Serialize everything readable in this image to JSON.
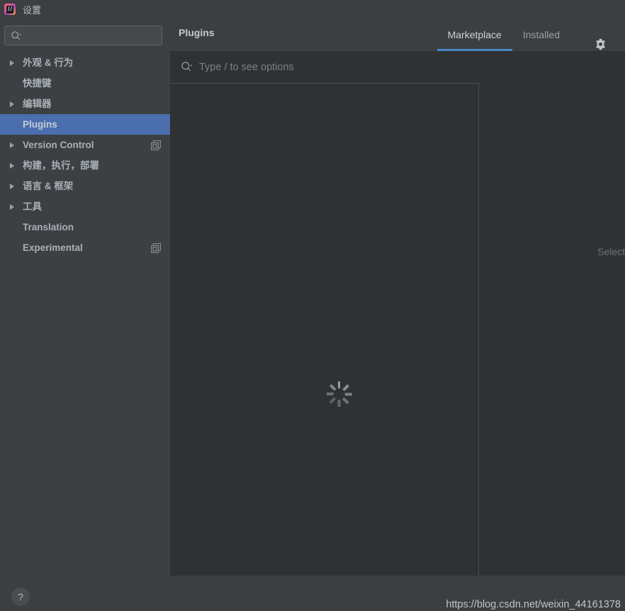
{
  "window": {
    "title": "设置",
    "app_icon": "intellij-idea-icon"
  },
  "sidebar": {
    "search": {
      "value": "",
      "placeholder": "",
      "icon": "search-icon"
    },
    "items": [
      {
        "label": "外观 & 行为",
        "expandable": true,
        "selected": false,
        "badge": ""
      },
      {
        "label": "快捷键",
        "expandable": false,
        "selected": false,
        "badge": ""
      },
      {
        "label": "编辑器",
        "expandable": true,
        "selected": false,
        "badge": ""
      },
      {
        "label": "Plugins",
        "expandable": false,
        "selected": true,
        "badge": ""
      },
      {
        "label": "Version Control",
        "expandable": true,
        "selected": false,
        "badge": "copy-icon"
      },
      {
        "label": "构建，执行，部署",
        "expandable": true,
        "selected": false,
        "badge": ""
      },
      {
        "label": "语言 & 框架",
        "expandable": true,
        "selected": false,
        "badge": ""
      },
      {
        "label": "工具",
        "expandable": true,
        "selected": false,
        "badge": ""
      },
      {
        "label": "Translation",
        "expandable": false,
        "selected": false,
        "badge": ""
      },
      {
        "label": "Experimental",
        "expandable": false,
        "selected": false,
        "badge": "copy-icon"
      }
    ]
  },
  "main": {
    "title": "Plugins",
    "tabs": [
      {
        "label": "Marketplace",
        "active": true
      },
      {
        "label": "Installed",
        "active": false
      }
    ],
    "settings_icon": "gear-icon",
    "search": {
      "value": "",
      "placeholder": "Type / to see options",
      "icon": "search-icon"
    },
    "loading": {
      "state": "loading",
      "icon": "spinner-icon"
    },
    "detail_placeholder": "Select"
  },
  "footer": {
    "help_label": "?",
    "watermark": "https://blog.csdn.net/weixin_44161378"
  },
  "colors": {
    "titlebar_bg": "#3c3f41",
    "sidebar_bg": "#3c4043",
    "content_bg": "#2f3133",
    "selection_blue": "#4b6eaf",
    "tab_accent": "#4a88c7",
    "text_primary": "#a9b0b8",
    "text_muted": "#7b8186"
  }
}
